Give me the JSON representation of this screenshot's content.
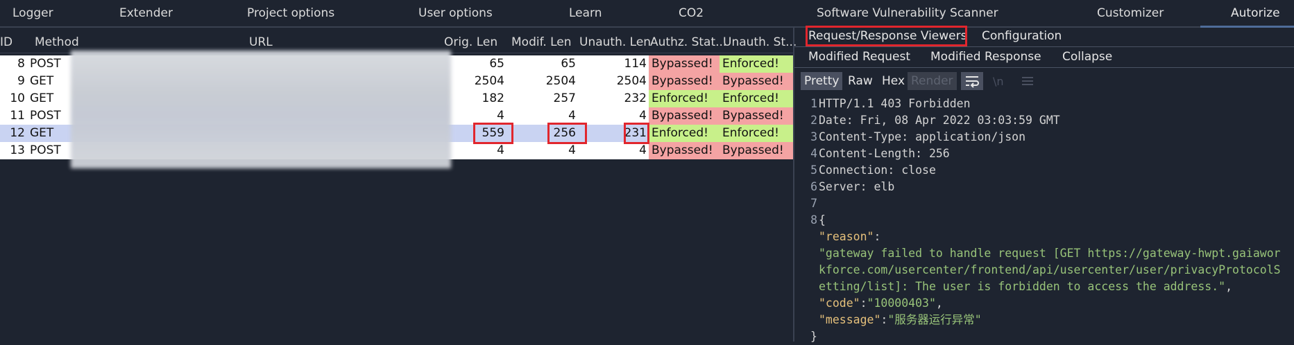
{
  "top_tabs": [
    "Logger",
    "Extender",
    "Project options",
    "User options",
    "Learn",
    "CO2",
    "Software Vulnerability Scanner",
    "Customizer",
    "Autorize"
  ],
  "table": {
    "headers": {
      "id": "ID",
      "method": "Method",
      "url": "URL",
      "orig": "Orig. Len",
      "modif": "Modif. Len",
      "unauth": "Unauth. Len",
      "authz": "Authz. Stat...",
      "unauth_status": "Unauth. St..."
    },
    "rows": [
      {
        "id": "8",
        "method": "POST",
        "orig": "65",
        "modif": "65",
        "unauth": "114",
        "authz": "Bypassed!",
        "ustatus": "Enforced!"
      },
      {
        "id": "9",
        "method": "GET",
        "orig": "2504",
        "modif": "2504",
        "unauth": "2504",
        "authz": "Bypassed!",
        "ustatus": "Bypassed!"
      },
      {
        "id": "10",
        "method": "GET",
        "orig": "182",
        "modif": "257",
        "unauth": "232",
        "authz": "Enforced!",
        "ustatus": "Enforced!"
      },
      {
        "id": "11",
        "method": "POST",
        "orig": "4",
        "modif": "4",
        "unauth": "4",
        "authz": "Bypassed!",
        "ustatus": "Bypassed!"
      },
      {
        "id": "12",
        "method": "GET",
        "orig": "559",
        "modif": "256",
        "unauth": "231",
        "authz": "Enforced!",
        "ustatus": "Enforced!"
      },
      {
        "id": "13",
        "method": "POST",
        "orig": "4",
        "modif": "4",
        "unauth": "4",
        "authz": "Bypassed!",
        "ustatus": "Bypassed!"
      }
    ],
    "selected_row_id": "12"
  },
  "right_pane": {
    "tabs": [
      "Request/Response Viewers",
      "Configuration"
    ],
    "subtabs": [
      "Modified Request",
      "Modified Response",
      "Collapse"
    ],
    "viewer_buttons": [
      "Pretty",
      "Raw",
      "Hex",
      "Render"
    ],
    "viewer_icons": [
      "wrap-lines-icon",
      "newline-icon",
      "menu-icon"
    ]
  },
  "response": {
    "lines": [
      {
        "n": "1",
        "text": "HTTP/1.1 403 Forbidden"
      },
      {
        "n": "2",
        "text": "Date: Fri, 08 Apr 2022 03:03:59 GMT"
      },
      {
        "n": "3",
        "text": "Content-Type: application/json"
      },
      {
        "n": "4",
        "text": "Content-Length: 256"
      },
      {
        "n": "5",
        "text": "Connection: close"
      },
      {
        "n": "6",
        "text": "Server: elb"
      },
      {
        "n": "7",
        "text": ""
      },
      {
        "n": "8",
        "text": "{"
      }
    ],
    "json": {
      "reason_key": "\"reason\"",
      "reason_value_lines": [
        "\"gateway failed to handle request [GET https://gateway-hwpt.gaiawor",
        "kforce.com/usercenter/frontend/api/usercenter/user/privacyProtocolS",
        "etting/list]: The user is forbidden to access the address.\""
      ],
      "code_key": "\"code\"",
      "code_value": "\"10000403\"",
      "message_key": "\"message\"",
      "message_value": "\"服务器运行异常\"",
      "close": "}"
    }
  },
  "colors": {
    "bypassed": "#f4a3a3",
    "enforced": "#c8f08a",
    "highlight_box": "#e1262d"
  }
}
